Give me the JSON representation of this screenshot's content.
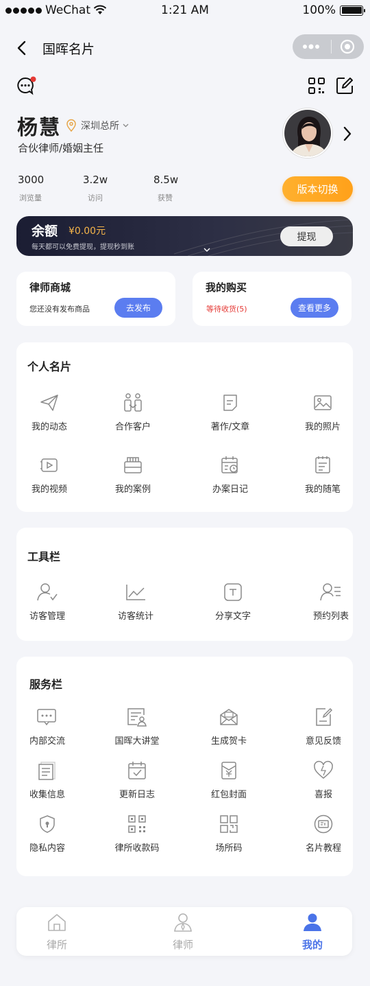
{
  "status_bar": {
    "carrier": "WeChat",
    "time": "1:21 AM",
    "battery": "100%",
    "battery_level": 1.0
  },
  "nav": {
    "title": "国晖名片"
  },
  "profile": {
    "name": "杨慧",
    "office": "深圳总所",
    "title": "合伙律师/婚姻主任",
    "stats": [
      {
        "value": "3000",
        "label": "浏览量"
      },
      {
        "value": "3.2w",
        "label": "访问"
      },
      {
        "value": "8.5w",
        "label": "获赞"
      }
    ],
    "switch_label": "版本切换"
  },
  "balance": {
    "label": "余额",
    "amount": "¥0.00元",
    "tip": "每天都可以免费提现，提现秒到账",
    "withdraw_label": "提现"
  },
  "shop": {
    "title": "律师商城",
    "desc": "您还没有发布商品",
    "button": "去发布"
  },
  "purchase": {
    "title": "我的购买",
    "status": "等待收货(5)",
    "button": "查看更多"
  },
  "personal_card": {
    "title": "个人名片",
    "items": [
      {
        "label": "我的动态",
        "icon": "paper-plane-icon"
      },
      {
        "label": "合作客户",
        "icon": "clients-icon"
      },
      {
        "label": "著作/文章",
        "icon": "article-icon"
      },
      {
        "label": "我的照片",
        "icon": "photo-icon"
      },
      {
        "label": "我的视频",
        "icon": "video-icon"
      },
      {
        "label": "我的案例",
        "icon": "case-icon"
      },
      {
        "label": "办案日记",
        "icon": "calendar-clock-icon"
      },
      {
        "label": "我的随笔",
        "icon": "notes-icon"
      }
    ]
  },
  "toolbar": {
    "title": "工具栏",
    "items": [
      {
        "label": "访客管理",
        "icon": "user-check-icon"
      },
      {
        "label": "访客统计",
        "icon": "line-chart-icon"
      },
      {
        "label": "分享文字",
        "icon": "text-share-icon"
      },
      {
        "label": "预约列表",
        "icon": "user-list-icon"
      }
    ]
  },
  "service": {
    "title": "服务栏",
    "items": [
      {
        "label": "内部交流",
        "icon": "chat-icon"
      },
      {
        "label": "国晖大讲堂",
        "icon": "lecture-icon"
      },
      {
        "label": "生成贺卡",
        "icon": "envelope-icon"
      },
      {
        "label": "意见反馈",
        "icon": "feedback-icon"
      },
      {
        "label": "收集信息",
        "icon": "document-icon"
      },
      {
        "label": "更新日志",
        "icon": "calendar-check-icon"
      },
      {
        "label": "红包封面",
        "icon": "red-packet-icon"
      },
      {
        "label": "喜报",
        "icon": "heart-icon"
      },
      {
        "label": "隐私内容",
        "icon": "shield-lock-icon"
      },
      {
        "label": "律所收款码",
        "icon": "qr-code-icon"
      },
      {
        "label": "场所码",
        "icon": "place-code-icon"
      },
      {
        "label": "名片教程",
        "icon": "card-tutorial-icon"
      }
    ]
  },
  "tabbar": {
    "items": [
      {
        "label": "律所",
        "icon": "home-icon"
      },
      {
        "label": "律师",
        "icon": "lawyer-icon"
      },
      {
        "label": "我的",
        "icon": "person-icon"
      }
    ],
    "active_color": "#4a73e8"
  },
  "colors": {
    "accent": "#5b7df0",
    "orange": "#ffa11a",
    "alert": "#e53935"
  }
}
